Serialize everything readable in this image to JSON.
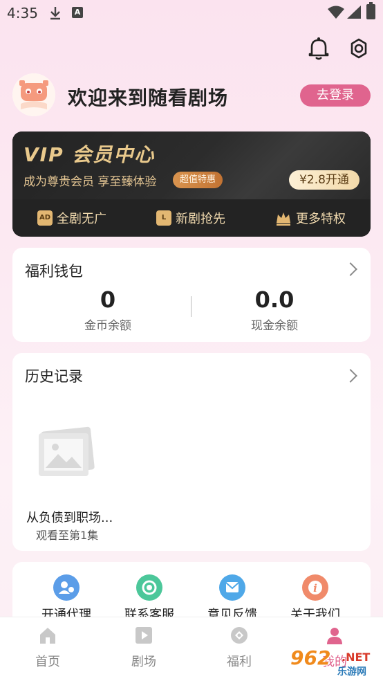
{
  "status_bar": {
    "time": "4:35"
  },
  "profile": {
    "welcome": "欢迎来到随看剧场",
    "login_label": "去登录"
  },
  "vip": {
    "title": "VIP 会员中心",
    "subtitle": "成为尊贵会员 享至臻体验",
    "badge": "超值特惠",
    "open_label": "¥2.8开通",
    "benefits": [
      {
        "icon_text": "AD",
        "label": "全剧无广"
      },
      {
        "icon_text": "L",
        "label": "新剧抢先"
      },
      {
        "icon_text": "",
        "label": "更多特权"
      }
    ]
  },
  "wallet": {
    "title": "福利钱包",
    "coins_value": "0",
    "coins_label": "金币余额",
    "cash_value": "0.0",
    "cash_label": "现金余额"
  },
  "history": {
    "title": "历史记录",
    "items": [
      {
        "name": "从负债到职场...",
        "progress": "观看至第1集"
      }
    ]
  },
  "services": [
    {
      "label": "开通代理",
      "color": "#5b9de8"
    },
    {
      "label": "联系客服",
      "color": "#4cc79a"
    },
    {
      "label": "意见反馈",
      "color": "#4fa8e8"
    },
    {
      "label": "关于我们",
      "color": "#f08a6a"
    }
  ],
  "tabs": [
    {
      "label": "首页"
    },
    {
      "label": "剧场"
    },
    {
      "label": "福利"
    },
    {
      "label": "我的"
    }
  ],
  "watermark": {
    "num": "962",
    "net": ".NET",
    "cn": "乐游网"
  },
  "colors": {
    "accent": "#e0648e",
    "vip_gold": "#e9c98c"
  }
}
